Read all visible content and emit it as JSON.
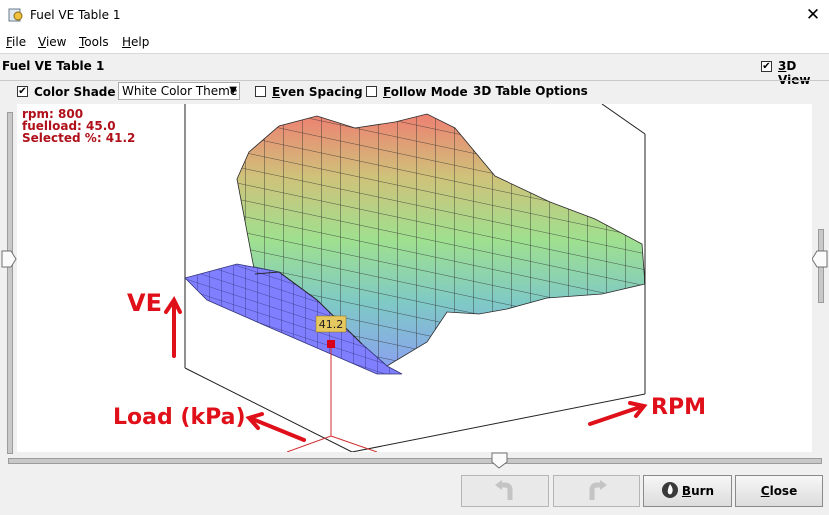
{
  "window": {
    "title": "Fuel VE Table 1",
    "close_glyph": "✕"
  },
  "menu": [
    {
      "key": "F",
      "rest": "ile"
    },
    {
      "key": "V",
      "rest": "iew"
    },
    {
      "key": "T",
      "rest": "ools"
    },
    {
      "key": "H",
      "rest": "elp"
    }
  ],
  "panel": {
    "title": "Fuel VE Table 1",
    "view3d": {
      "key": "3",
      "rest": "D View",
      "checked": true
    }
  },
  "options": {
    "color_shade": {
      "label": "Color Shade",
      "checked": true
    },
    "theme": {
      "value": "White Color Theme"
    },
    "even_spacing": {
      "key": "E",
      "rest": "ven Spacing",
      "checked": false
    },
    "follow_mode": {
      "key": "F",
      "rest": "ollow Mode",
      "checked": false
    },
    "table_options": "3D Table Options"
  },
  "readout": {
    "rpm": "rpm: 800",
    "fuelload": "fuelload: 45.0",
    "selected": "Selected %: 41.2"
  },
  "marker": {
    "value": "41.2"
  },
  "annotations": {
    "ve": "VE",
    "load": "Load (kPa)",
    "rpm": "RPM",
    "color": "#e0101a"
  },
  "buttons": {
    "burn": {
      "key": "B",
      "rest": "urn"
    },
    "close": {
      "key": "C",
      "rest": "lose"
    }
  },
  "colors": {
    "grid_blue": "#7f7fff",
    "accent_red": "#b0101a"
  }
}
